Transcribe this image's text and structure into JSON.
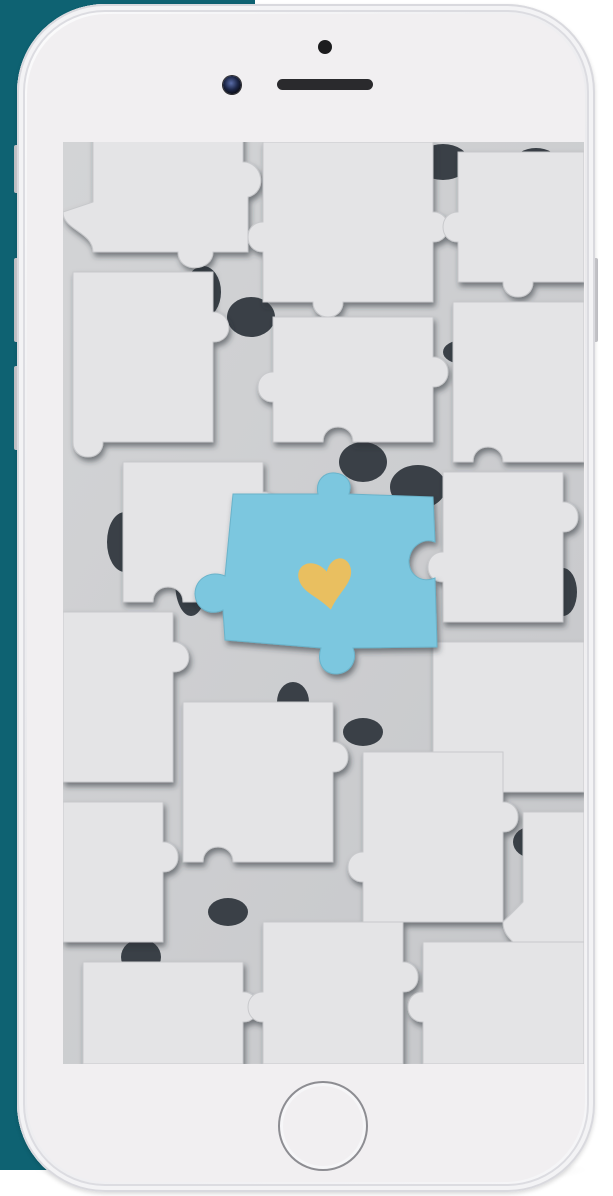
{
  "page": {
    "background_accent": "#0e6272",
    "device": "smartphone-mockup"
  },
  "screen": {
    "content": "jigsaw-puzzle-photo",
    "piece_color": "#e3e3e4",
    "highlight_piece_color": "#7cc7df",
    "heart_color": "#e9bf60"
  },
  "icons": {
    "highlight": "heart-icon",
    "home": "home-button"
  }
}
